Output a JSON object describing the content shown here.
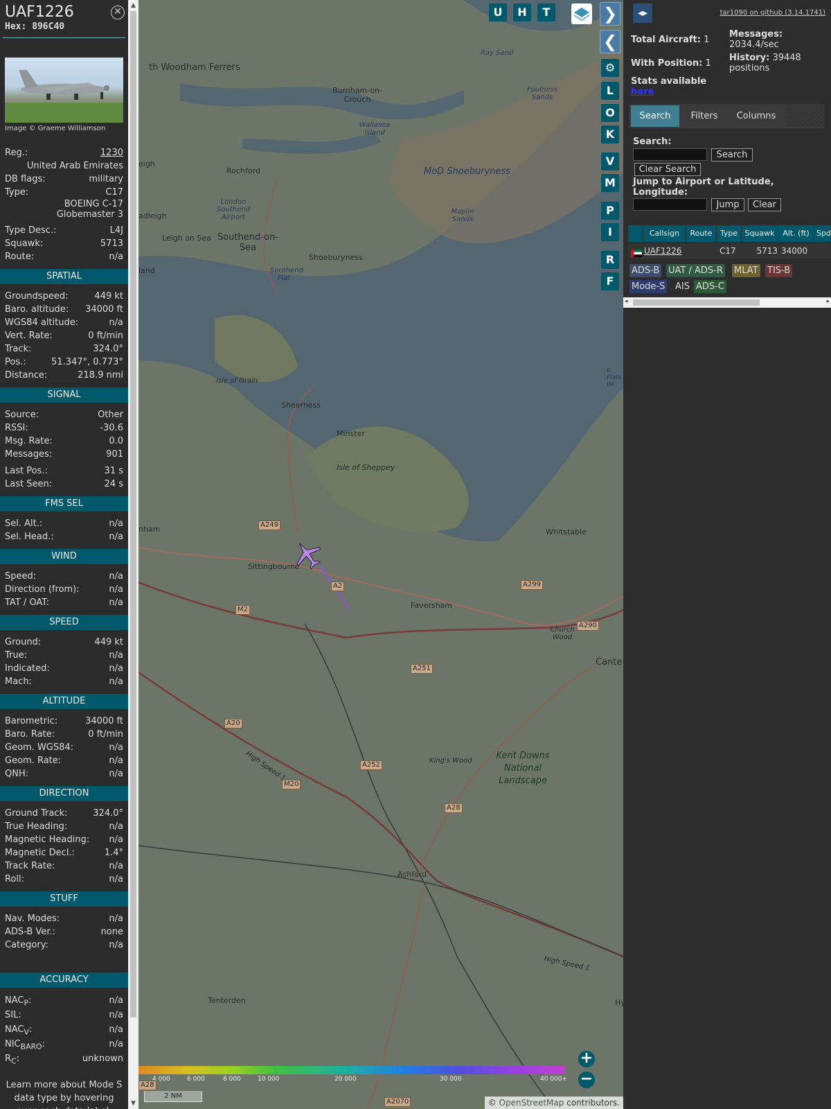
{
  "aircraft": {
    "callsign": "UAF1226",
    "hex_label": "Hex:",
    "hex": "896C40",
    "image_credit": "Image © Graeme Williamson",
    "reg_label": "Reg.:",
    "reg": "1230",
    "country": "United Arab Emirates",
    "dbflags_label": "DB flags:",
    "dbflags": "military",
    "type_label": "Type:",
    "type": "C17",
    "type_name_line1": "BOEING C-17",
    "type_name_line2": "Globemaster 3",
    "typedesc_label": "Type Desc.:",
    "typedesc": "L4J",
    "squawk_label": "Squawk:",
    "squawk": "5713",
    "route_label": "Route:",
    "route": "n/a"
  },
  "sections": {
    "spatial": {
      "title": "SPATIAL",
      "rows": [
        {
          "label": "Groundspeed:",
          "value": "449 kt"
        },
        {
          "label": "Baro. altitude:",
          "value": "34000 ft"
        },
        {
          "label": "WGS84 altitude:",
          "value": "n/a"
        },
        {
          "label": "Vert. Rate:",
          "value": "0 ft/min"
        },
        {
          "label": "Track:",
          "value": "324.0°"
        },
        {
          "label": "Pos.:",
          "value": "51.347°, 0.773°"
        },
        {
          "label": "Distance:",
          "value": "218.9 nmi"
        }
      ]
    },
    "signal": {
      "title": "SIGNAL",
      "rows": [
        {
          "label": "Source:",
          "value": "Other"
        },
        {
          "label": "RSSI:",
          "value": "-30.6"
        },
        {
          "label": "Msg. Rate:",
          "value": "0.0"
        },
        {
          "label": "Messages:",
          "value": "901"
        },
        {
          "label": "Last Pos.:",
          "value": "31 s"
        },
        {
          "label": "Last Seen:",
          "value": "24 s"
        }
      ]
    },
    "fms": {
      "title": "FMS SEL",
      "rows": [
        {
          "label": "Sel. Alt.:",
          "value": "n/a"
        },
        {
          "label": "Sel. Head.:",
          "value": "n/a"
        }
      ]
    },
    "wind": {
      "title": "WIND",
      "rows": [
        {
          "label": "Speed:",
          "value": "n/a"
        },
        {
          "label": "Direction (from):",
          "value": "n/a"
        },
        {
          "label": "TAT / OAT:",
          "value": "n/a"
        }
      ]
    },
    "speed": {
      "title": "SPEED",
      "rows": [
        {
          "label": "Ground:",
          "value": "449 kt"
        },
        {
          "label": "True:",
          "value": "n/a"
        },
        {
          "label": "Indicated:",
          "value": "n/a"
        },
        {
          "label": "Mach:",
          "value": "n/a"
        }
      ]
    },
    "altitude": {
      "title": "ALTITUDE",
      "rows": [
        {
          "label": "Barometric:",
          "value": "34000 ft"
        },
        {
          "label": "Baro. Rate:",
          "value": "0 ft/min"
        },
        {
          "label": "Geom. WGS84:",
          "value": "n/a"
        },
        {
          "label": "Geom. Rate:",
          "value": "n/a"
        },
        {
          "label": "QNH:",
          "value": "n/a"
        }
      ]
    },
    "direction": {
      "title": "DIRECTION",
      "rows": [
        {
          "label": "Ground Track:",
          "value": "324.0°"
        },
        {
          "label": "True Heading:",
          "value": "n/a"
        },
        {
          "label": "Magnetic Heading:",
          "value": "n/a"
        },
        {
          "label": "Magnetic Decl.:",
          "value": "1.4°"
        },
        {
          "label": "Track Rate:",
          "value": "n/a"
        },
        {
          "label": "Roll:",
          "value": "n/a"
        }
      ]
    },
    "stuff": {
      "title": "STUFF",
      "rows": [
        {
          "label": "Nav. Modes:",
          "value": "n/a"
        },
        {
          "label": "ADS-B Ver.:",
          "value": "none"
        },
        {
          "label": "Category:",
          "value": "n/a"
        }
      ]
    },
    "accuracy": {
      "title": "ACCURACY",
      "nacp_base": "NAC",
      "nacp_sub": "P",
      "nacp": "n/a",
      "sil_label": "SIL:",
      "sil": "n/a",
      "nacv_base": "NAC",
      "nacv_sub": "V",
      "nacv": "n/a",
      "nic_base": "NIC",
      "nic_sub": "BARO",
      "nic": "n/a",
      "rc_base": "R",
      "rc_sub": "C",
      "rc": "unknown"
    },
    "footer_note": "Learn more about Mode S data type by hovering over each data label."
  },
  "map": {
    "toolbar": [
      "U",
      "H",
      "T"
    ],
    "side_buttons": [
      "L",
      "O",
      "K",
      "V",
      "M",
      "P",
      "I",
      "R",
      "F"
    ],
    "places": {
      "woodham": "th Woodham Ferrers",
      "burnham": "Burnham-on-Crouch",
      "wallasea": "Wallasea Island",
      "rayle": "eigh",
      "rochford": "Rochford",
      "lsa": "London Southend Airport",
      "mod": "MoD Shoeburyness",
      "maplin": "Maplin Sands",
      "foulness": "Foulness Sands",
      "raysand": "Ray Sand",
      "hadleigh": "adleigh",
      "leigh": "Leigh on Sea",
      "southend": "Southend-on-Sea",
      "shoeburyness": "Shoeburyness",
      "southendflat": "Southend Flat",
      "land": "land",
      "grain": "Isle of Grain",
      "sheerness": "Sheerness",
      "minster": "Minster",
      "sheppey": "Isle of Sheppey",
      "whitstable": "Whitstable",
      "nham": "nham",
      "sittingbourne": "Sittingbourne",
      "faversham": "Faversham",
      "churchwood": "Church Wood",
      "cante": "Cante",
      "kingswood": "King's Wood",
      "kentdowns": "Kent Downs National Landscape",
      "ashford": "Ashford",
      "tenterden": "Tenterden",
      "hy": "Hy",
      "flats": "K Flats Wi",
      "hs1": "High Speed 1",
      "hs1b": "High Speed 1"
    },
    "roads": [
      "A249",
      "A2",
      "A299",
      "A290",
      "M2",
      "A251",
      "A20",
      "A252",
      "M20",
      "A28",
      "A28",
      "A2070"
    ],
    "altitude_scale": [
      "4 000",
      "6 000",
      "8 000",
      "10 000",
      "20 000",
      "30 000",
      "40 000+"
    ],
    "scale_bar": "2 NM",
    "attribution_prefix": "©",
    "attribution_link": "OpenStreetMap",
    "attribution_suffix": "contributors."
  },
  "panel": {
    "github": "tar1090 on github (3.14.1741)",
    "total_label": "Total Aircraft:",
    "total": "1",
    "withpos_label": "With Position:",
    "withpos": "1",
    "stats_label": "Stats available",
    "stats_link": "here",
    "messages_label": "Messages:",
    "messages": "2034.4/sec",
    "history_label": "History:",
    "history": "39448 positions",
    "tabs": [
      "Search",
      "Filters",
      "Columns"
    ],
    "search_label": "Search:",
    "search_button": "Search",
    "clear_search": "Clear Search",
    "jump_label": "Jump to Airport or Latitude, Longitude:",
    "jump_button": "Jump",
    "clear_button": "Clear",
    "columns": [
      "Callsign",
      "Route",
      "Type",
      "Squawk",
      "Alt. (ft)",
      "Spd"
    ],
    "row": {
      "callsign": "UAF1226",
      "route": "",
      "type": "C17",
      "squawk": "5713",
      "alt": "34000"
    },
    "sources": [
      {
        "label": "ADS-B",
        "color": "#3c4e6e"
      },
      {
        "label": "UAT / ADS-R",
        "color": "#2f5a44"
      },
      {
        "label": "MLAT",
        "color": "#6e6230"
      },
      {
        "label": "TIS-B",
        "color": "#6e3434"
      },
      {
        "label": "Mode-S",
        "color": "#2f3c6e"
      },
      {
        "label": "AIS",
        "color": "#2d2d2d"
      },
      {
        "label": "ADS-C",
        "color": "#2f5a38"
      }
    ]
  }
}
